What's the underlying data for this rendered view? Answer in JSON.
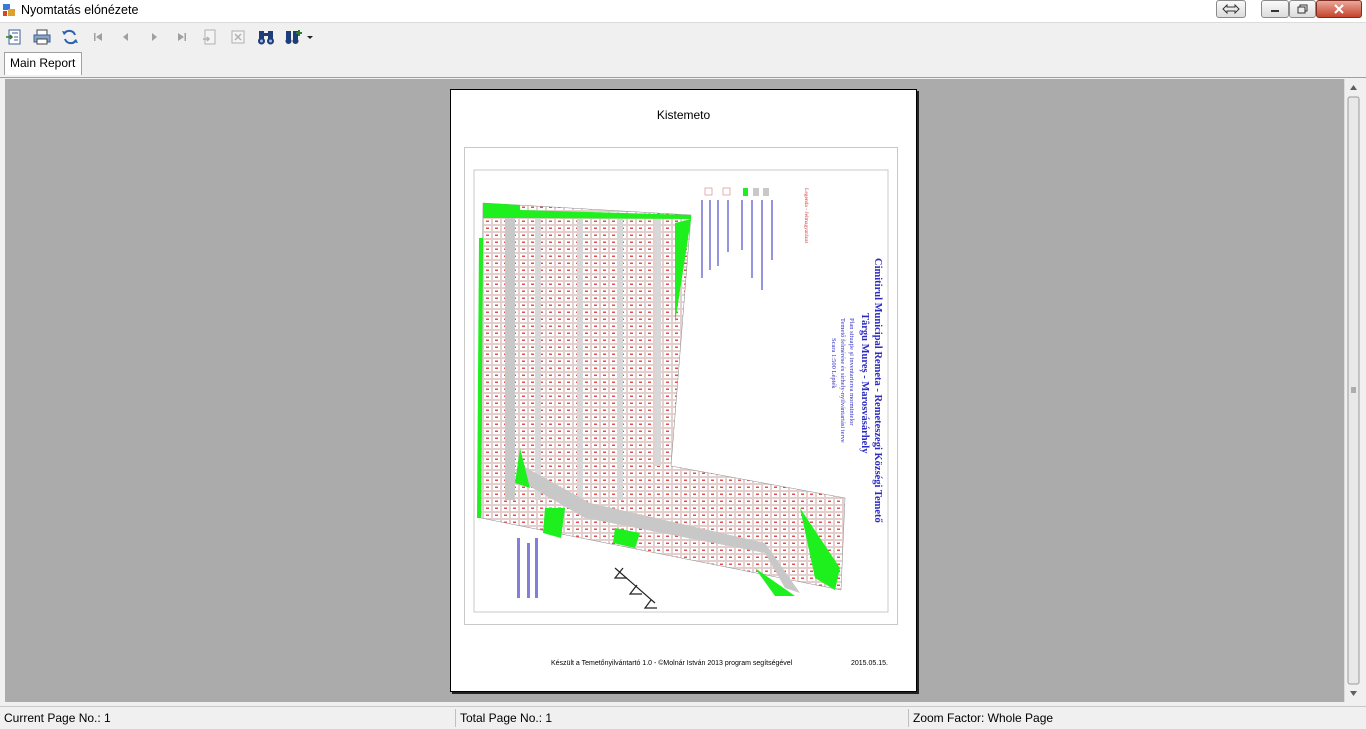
{
  "window": {
    "title": "Nyomtatás elónézete"
  },
  "tabs": [
    {
      "label": "Main Report"
    }
  ],
  "report": {
    "title": "Kistemeto",
    "footer": "Készült a Temetőnyilvántartó 1.0 - ©Molnár István 2013 program segítségével",
    "date": "2015.05.15.",
    "map": {
      "heading_lines": [
        "Cimitirul Municipal Remeta - Remeteszegi Községi Temető",
        "Târgu Mureș - Marosvásárhely"
      ],
      "sub_lines": [
        "Plan situaţie şi inventarierea mormintelor",
        "Temető felmérése és sírhely-nyilvántartási terve",
        "Scara 1:500 Lépték"
      ],
      "legend_title": "Legenda - Jelmagyarázat"
    }
  },
  "status": {
    "current_page": "Current Page No.: 1",
    "total_page": "Total Page No.: 1",
    "zoom": "Zoom Factor: Whole Page"
  },
  "colors": {
    "viewer_bg": "#ababab",
    "green": "#1ef01e",
    "road": "#c8c8c8",
    "heading": "#2b2bc0",
    "legend_red": "#d03030"
  }
}
